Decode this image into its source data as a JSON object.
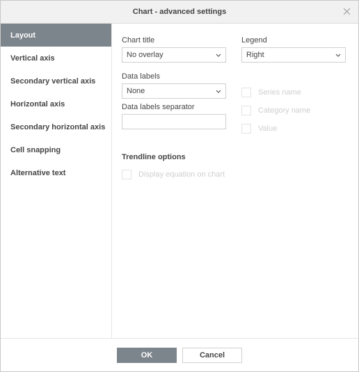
{
  "window": {
    "title": "Chart - advanced settings"
  },
  "sidebar": {
    "items": [
      {
        "label": "Layout",
        "active": true
      },
      {
        "label": "Vertical axis",
        "active": false
      },
      {
        "label": "Secondary vertical axis",
        "active": false
      },
      {
        "label": "Horizontal axis",
        "active": false
      },
      {
        "label": "Secondary horizontal axis",
        "active": false
      },
      {
        "label": "Cell snapping",
        "active": false
      },
      {
        "label": "Alternative text",
        "active": false
      }
    ]
  },
  "form": {
    "chartTitle": {
      "label": "Chart title",
      "value": "No overlay"
    },
    "legend": {
      "label": "Legend",
      "value": "Right"
    },
    "dataLabels": {
      "label": "Data labels",
      "value": "None"
    },
    "seriesName": {
      "label": "Series name"
    },
    "categoryName": {
      "label": "Category name"
    },
    "valueCheckbox": {
      "label": "Value"
    },
    "separator": {
      "label": "Data labels separator",
      "value": ""
    },
    "trendline": {
      "header": "Trendline options",
      "equation": "Display equation on chart"
    }
  },
  "footer": {
    "ok": "OK",
    "cancel": "Cancel"
  }
}
